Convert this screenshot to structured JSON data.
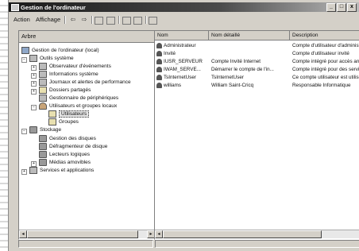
{
  "window": {
    "title": "Gestion de l'ordinateur",
    "btn_min": "_",
    "btn_max": "□",
    "btn_close": "x"
  },
  "menu": {
    "action": "Action",
    "view": "Affichage"
  },
  "toolbar": {
    "back": "⇦",
    "forward": "⇨"
  },
  "tree": {
    "header": "Arbre",
    "root": "Gestion de l'ordinateur (local)",
    "system_tools": "Outils système",
    "event_viewer": "Observateur d'événements",
    "system_info": "Informations système",
    "logs_alerts": "Journaux et alertes de performance",
    "shared_folders": "Dossiers partagés",
    "device_manager": "Gestionnaire de périphériques",
    "local_users_groups": "Utilisateurs et groupes locaux",
    "users": "Utilisateurs",
    "groups": "Groupes",
    "storage": "Stockage",
    "disk_mgmt": "Gestion des disques",
    "defrag": "Défragmenteur de disque",
    "logical_drives": "Lecteurs logiques",
    "removable_media": "Médias amovibles",
    "services_apps": "Services et applications"
  },
  "list": {
    "columns": [
      "Nom",
      "Nom détaillé",
      "Description"
    ],
    "rows": [
      {
        "name": "Administrateur",
        "fullname": "",
        "description": "Compte d'utilisateur d'administration"
      },
      {
        "name": "Invité",
        "fullname": "",
        "description": "Compte d'utilisateur invité"
      },
      {
        "name": "IUSR_SERVEUR",
        "fullname": "Compte Invité Internet",
        "description": "Compte intégré pour accès anonyme"
      },
      {
        "name": "IWAM_SERVE...",
        "fullname": "Démarrer le compte de l'in...",
        "description": "Compte intégré pour des services"
      },
      {
        "name": "TsInternetUser",
        "fullname": "TsInternetUser",
        "description": "Ce compte utilisateur est utilisé"
      },
      {
        "name": "williams",
        "fullname": "William Saint-Cricq",
        "description": "Responsable Informatique"
      }
    ]
  },
  "scroll": {
    "left": "◂",
    "right": "▸"
  }
}
